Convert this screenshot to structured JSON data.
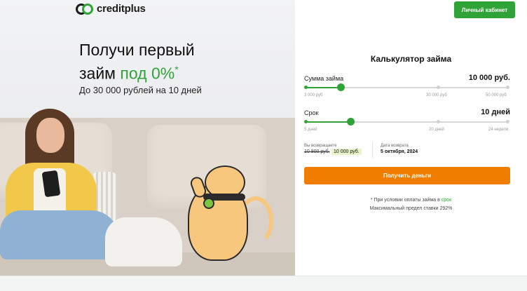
{
  "brand": {
    "name": "creditplus",
    "accent": "#2fa338",
    "cta": "#f07d00"
  },
  "header": {
    "cabinet_label": "Личный кабинет"
  },
  "hero": {
    "headline_line1": "Получи первый",
    "headline_line2_prefix": "займ ",
    "headline_accent": "под 0%",
    "headline_sup": "*",
    "subhead": "До 30 000 рублей на 10 дней"
  },
  "calculator": {
    "title": "Калькулятор займа",
    "amount": {
      "label": "Сумма займа",
      "value": "10 000 руб.",
      "ticks": [
        "3 000 руб",
        "30 000 руб",
        "50 000 руб"
      ],
      "position": 0.17
    },
    "term": {
      "label": "Срок",
      "value": "10 дней",
      "ticks": [
        "5 дней",
        "20 дней",
        "24 недели"
      ],
      "position": 0.22
    },
    "summary": {
      "return_label": "Вы возвращаете",
      "old_amount": "10 800 руб.",
      "new_amount": "10 000 руб.",
      "date_label": "Дата возврата",
      "date_value": "5 октября, 2024"
    },
    "submit_label": "Получить деньги",
    "note_prefix": "* При условии оплаты займа в ",
    "note_link": "срок",
    "note_line2": "Максимальный предел ставки 292%"
  }
}
